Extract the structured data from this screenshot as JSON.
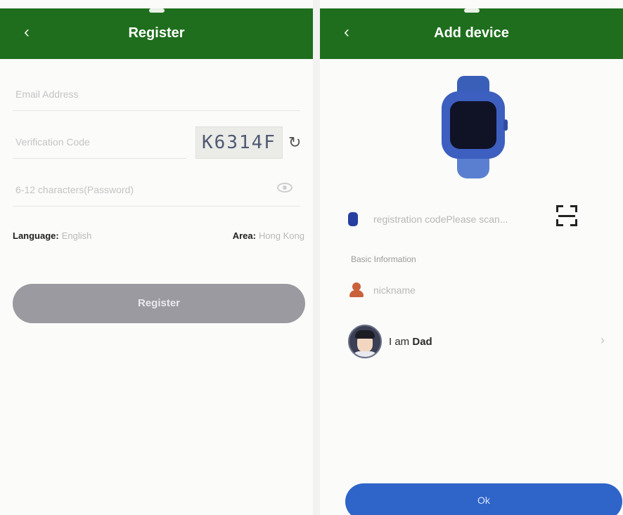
{
  "register": {
    "title": "Register",
    "back_icon": "chevron-left-icon",
    "email_placeholder": "Email Address",
    "verification_placeholder": "Verification Code",
    "captcha_text": "K6314F",
    "refresh_icon": "refresh-icon",
    "password_placeholder": "6-12 characters(Password)",
    "eye_icon": "eye-icon",
    "language_label": "Language:",
    "language_value": "English",
    "area_label": "Area:",
    "area_value": "Hong Kong",
    "register_button": "Register"
  },
  "add_device": {
    "title": "Add device",
    "back_icon": "chevron-left-icon",
    "watch_icon": "smartwatch-icon",
    "registration_placeholder": "registration codePlease scan...",
    "scan_icon": "scan-icon",
    "section_label": "Basic Information",
    "nickname_placeholder": "nickname",
    "relation_prefix": "I am",
    "relation_value": "Dad",
    "chevron_icon": "chevron-right-icon",
    "ok_button": "Ok"
  },
  "colors": {
    "header_green": "#1f6e1d",
    "register_button": "#9a9aa0",
    "ok_button": "#2f64c9",
    "watch_blue": "#3d5fc0"
  }
}
